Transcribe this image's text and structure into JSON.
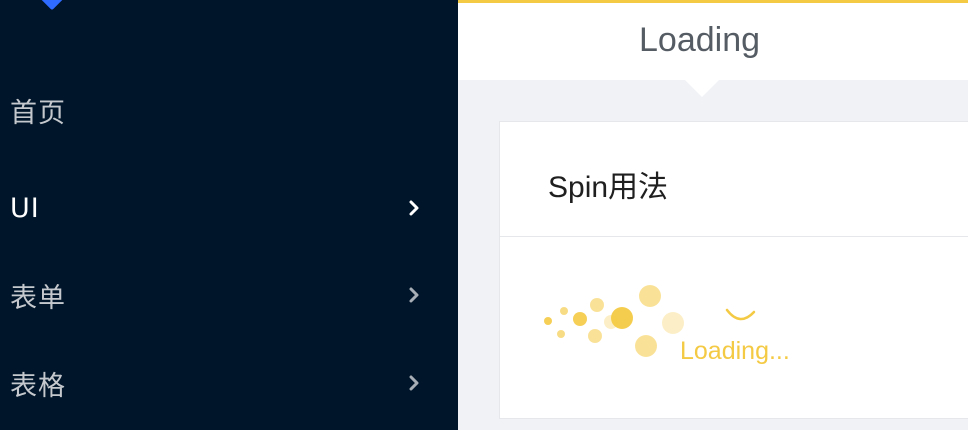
{
  "sidebar": {
    "items": [
      {
        "label": "首页",
        "has_submenu": false,
        "active": false
      },
      {
        "label": "UI",
        "has_submenu": true,
        "active": true
      },
      {
        "label": "表单",
        "has_submenu": true,
        "active": false
      },
      {
        "label": "表格",
        "has_submenu": true,
        "active": false
      }
    ]
  },
  "header": {
    "title": "Loading"
  },
  "card": {
    "title": "Spin用法",
    "loading_text": "Loading..."
  },
  "colors": {
    "sidebar_bg": "#001529",
    "accent": "#f4ca44",
    "logo": "#2f6bff"
  }
}
